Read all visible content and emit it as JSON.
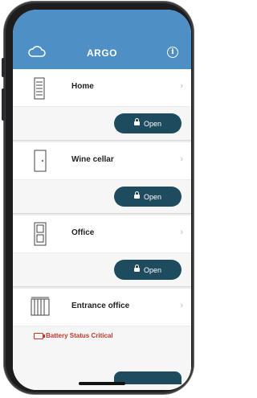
{
  "header": {
    "title": "ARGO",
    "cloud_icon": "cloud-icon",
    "info_icon": "info-icon"
  },
  "accent": "#4e8fc6",
  "button_color": "#1e4b5e",
  "doors": [
    {
      "name": "Home",
      "icon": "server-cabinet-icon",
      "open_label": "Open"
    },
    {
      "name": "Wine cellar",
      "icon": "door-icon",
      "open_label": "Open"
    },
    {
      "name": "Office",
      "icon": "cabinet-icon",
      "open_label": "Open"
    },
    {
      "name": "Entrance office",
      "icon": "gate-icon",
      "warning": "Battery Status Critical"
    }
  ]
}
